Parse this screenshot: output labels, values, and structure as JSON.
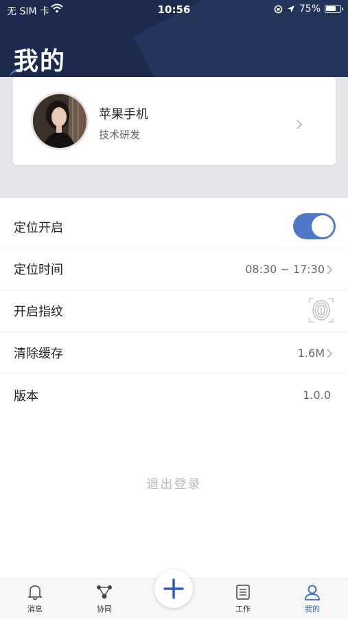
{
  "status_bar": {
    "carrier": "无 SIM 卡",
    "time": "10:56",
    "battery": "75%",
    "battery_level": 0.75
  },
  "header": {
    "title": "我的"
  },
  "profile": {
    "name": "苹果手机",
    "department": "技术研发"
  },
  "settings": {
    "location_enabled": {
      "label": "定位开启",
      "toggle_on": true
    },
    "location_time": {
      "label": "定位时间",
      "value": "08:30 ~ 17:30"
    },
    "fingerprint": {
      "label": "开启指纹"
    },
    "clear_cache": {
      "label": "清除缓存",
      "value": "1.6M"
    },
    "version": {
      "label": "版本",
      "value": "1.0.0"
    }
  },
  "logout_label": "退出登录",
  "tabbar": {
    "tabs": [
      {
        "label": "消息",
        "icon": "bell-icon"
      },
      {
        "label": "协同",
        "icon": "network-icon"
      },
      {
        "label": "工作",
        "icon": "document-icon"
      },
      {
        "label": "我的",
        "icon": "user-icon",
        "active": true
      }
    ],
    "center_icon": "plus-icon"
  },
  "colors": {
    "header_bg": "#1b2a4e",
    "accent": "#4f78c9",
    "active_tab": "#3467c4"
  }
}
